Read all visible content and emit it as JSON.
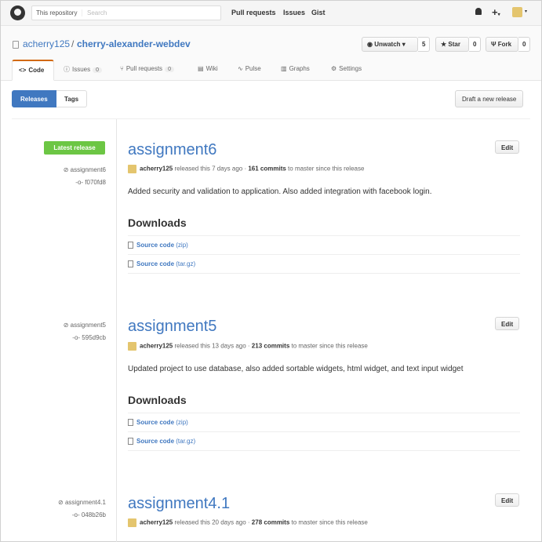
{
  "header": {
    "scope_label": "This repository",
    "search_placeholder": "Search",
    "nav": [
      "Pull requests",
      "Issues",
      "Gist"
    ],
    "plus": "+",
    "caret": "▾"
  },
  "repo": {
    "owner": "acherry125",
    "separator": "/",
    "name": "cherry-alexander-webdev",
    "watch_label": "Unwatch",
    "watch_count": "5",
    "star_label": "Star",
    "star_count": "0",
    "fork_label": "Fork",
    "fork_count": "0"
  },
  "tabs": [
    {
      "icon": "<>",
      "label": "Code"
    },
    {
      "icon": "ⓘ",
      "label": "Issues",
      "count": "0"
    },
    {
      "icon": "⑂",
      "label": "Pull requests",
      "count": "0"
    },
    {
      "icon": "▤",
      "label": "Wiki"
    },
    {
      "icon": "∿",
      "label": "Pulse"
    },
    {
      "icon": "▥",
      "label": "Graphs"
    },
    {
      "icon": "⚙",
      "label": "Settings"
    }
  ],
  "subnav": {
    "releases": "Releases",
    "tags": "Tags",
    "draft": "Draft a new release"
  },
  "latest_badge": "Latest release",
  "releases": [
    {
      "title": "assignment6",
      "tag": "assignment6",
      "commit": "f070fd8",
      "author": "acherry125",
      "released": "released this 7 days ago ·",
      "commits": "161 commits",
      "since": "to master since this release",
      "description": "Added security and validation to application. Also added integration with facebook login.",
      "downloads_heading": "Downloads",
      "downloads": [
        {
          "label": "Source code",
          "format": "(zip)"
        },
        {
          "label": "Source code",
          "format": "(tar.gz)"
        }
      ],
      "edit": "Edit"
    },
    {
      "title": "assignment5",
      "tag": "assignment5",
      "commit": "595d9cb",
      "author": "acherry125",
      "released": "released this 13 days ago ·",
      "commits": "213 commits",
      "since": "to master since this release",
      "description": "Updated project to use database, also added sortable widgets, html widget, and text input widget",
      "downloads_heading": "Downloads",
      "downloads": [
        {
          "label": "Source code",
          "format": "(zip)"
        },
        {
          "label": "Source code",
          "format": "(tar.gz)"
        }
      ],
      "edit": "Edit"
    },
    {
      "title": "assignment4.1",
      "tag": "assignment4.1",
      "commit": "048b26b",
      "author": "acherry125",
      "released": "released this 20 days ago ·",
      "commits": "278 commits",
      "since": "to master since this release",
      "edit": "Edit"
    }
  ],
  "colors": {
    "accent": "#4078c0",
    "latest": "#6cc644",
    "tab_highlight": "#d26911"
  }
}
